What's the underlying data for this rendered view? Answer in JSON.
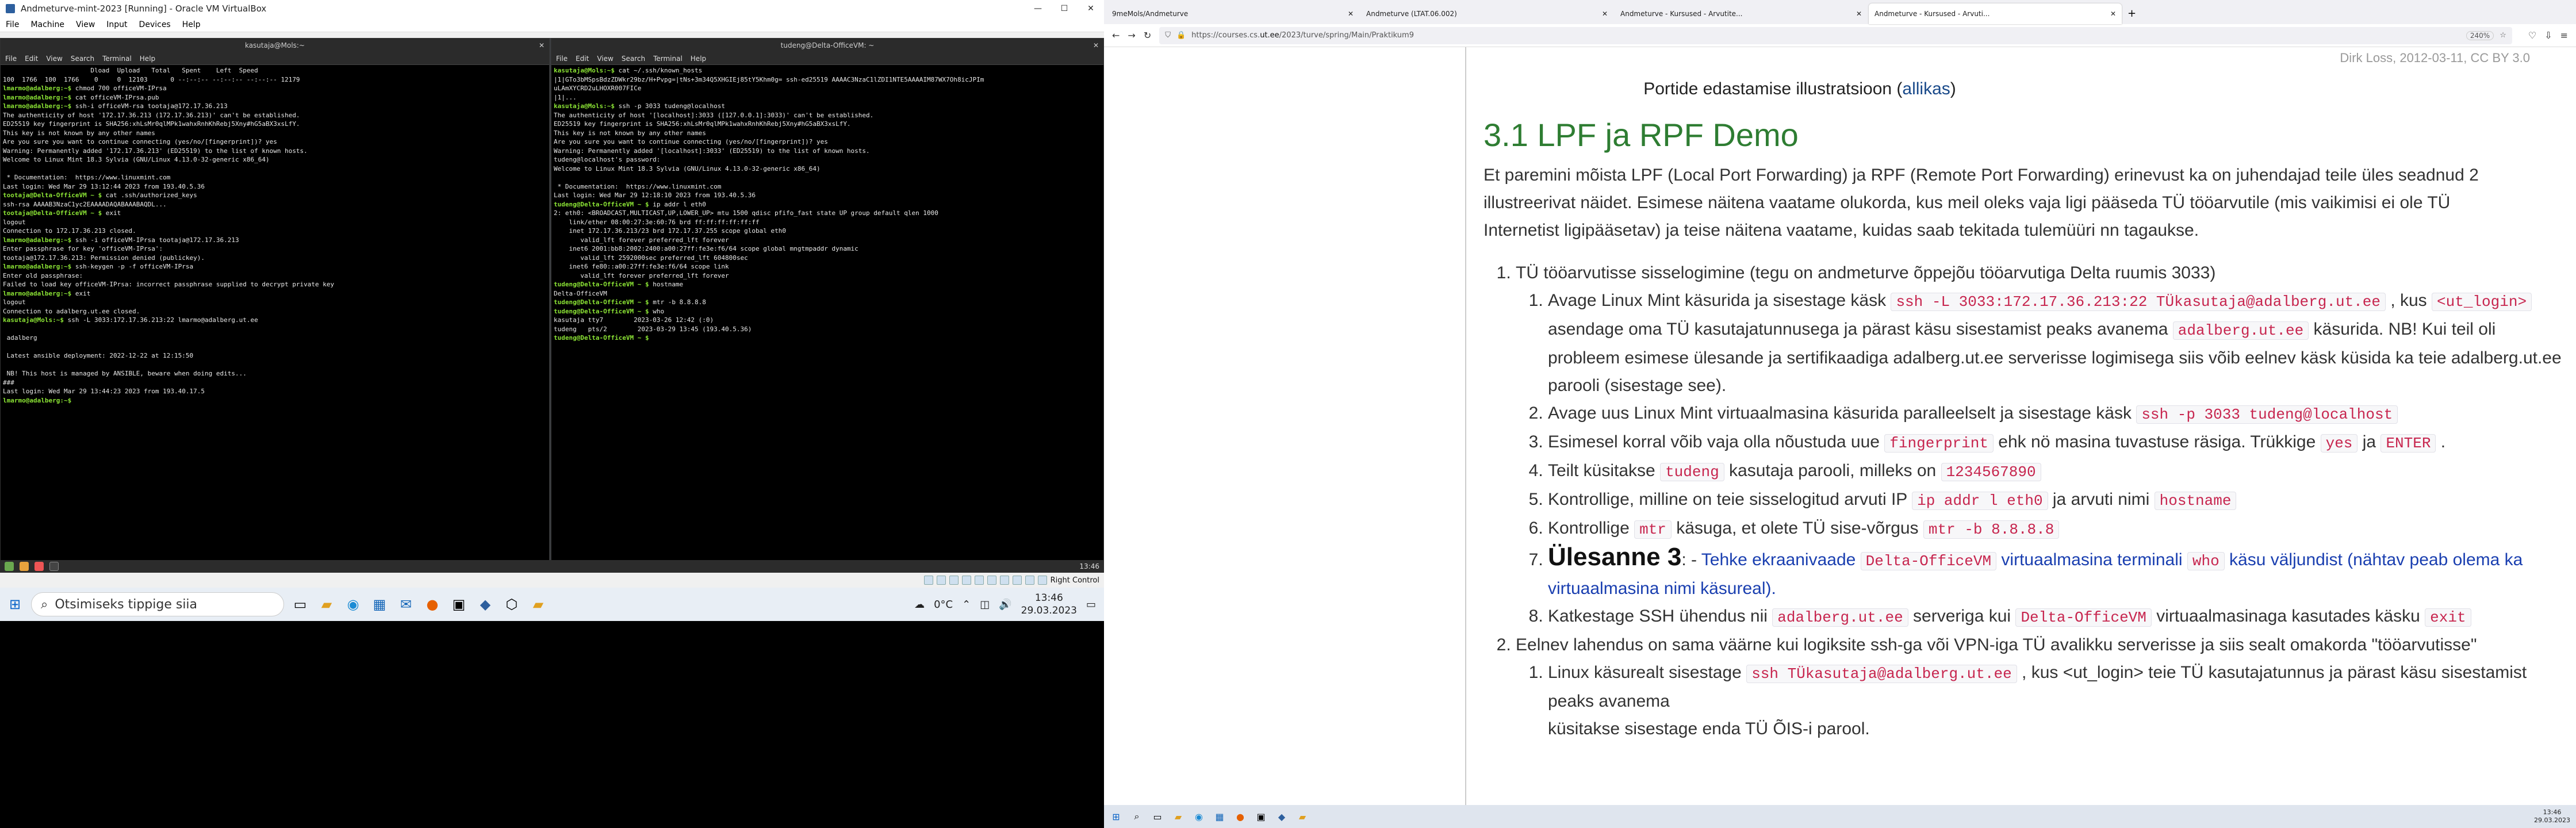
{
  "vbox": {
    "title": "Andmeturve-mint-2023 [Running] - Oracle VM VirtualBox",
    "menu": [
      "File",
      "Machine",
      "View",
      "Input",
      "Devices",
      "Help"
    ]
  },
  "term1": {
    "title": "kasutaja@Mols:~",
    "menu": [
      "File",
      "Edit",
      "View",
      "Search",
      "Terminal",
      "Help"
    ],
    "lines": [
      "                       Dload  Upload   Total   Spent    Left  Speed",
      "100  1766  100  1766    0     0  12103      0 --:--:-- --:--:-- --:--:-- 12179",
      "lmarmo@adalberg:~$ chmod 700 officeVM-IPrsa",
      "lmarmo@adalberg:~$ cat officeVM-IPrsa.pub",
      "lmarmo@adalberg:~$ ssh-i officeVM-rsa tootaja@172.17.36.213",
      "The authenticity of host '172.17.36.213 (172.17.36.213)' can't be established.",
      "ED25519 key fingerprint is SHA256:xhLsMr0qlMPk1wahxRnhKhRebj5Xny#hG5aBX3xsLfY.",
      "This key is not known by any other names",
      "Are you sure you want to continue connecting (yes/no/[fingerprint])? yes",
      "Warning: Permanently added '172.17.36.213' (ED25519) to the list of known hosts.",
      "Welcome to Linux Mint 18.3 Sylvia (GNU/Linux 4.13.0-32-generic x86_64)",
      "",
      " * Documentation:  https://www.linuxmint.com",
      "Last login: Wed Mar 29 13:12:44 2023 from 193.40.5.36",
      "tootaja@Delta-OfficeVM ~ $ cat .ssh/authorized_keys",
      "ssh-rsa AAAAB3NzaC1yc2EAAAADAQABAAABAQDL...",
      "tootaja@Delta-OfficeVM ~ $ exit",
      "logout",
      "Connection to 172.17.36.213 closed.",
      "lmarmo@adalberg:~$ ssh -i officeVM-IPrsa tootaja@172.17.36.213",
      "Enter passphrase for key 'officeVM-IPrsa':",
      "tootaja@172.17.36.213: Permission denied (publickey).",
      "lmarmo@adalberg:~$ ssh-keygen -p -f officeVM-IPrsa",
      "Enter old passphrase:",
      "Failed to load key officeVM-IPrsa: incorrect passphrase supplied to decrypt private key",
      "lmarmo@adalberg:~$ exit",
      "logout",
      "Connection to adalberg.ut.ee closed.",
      "kasutaja@Mols:~$ ssh -L 3033:172.17.36.213:22 lmarmo@adalberg.ut.ee",
      "",
      " adalberg",
      "",
      " Latest ansible deployment: 2022-12-22 at 12:15:50",
      "",
      " NB! This host is managed by ANSIBLE, beware when doing edits...",
      "###",
      "Last login: Wed Mar 29 13:44:23 2023 from 193.40.17.5",
      "lmarmo@adalberg:~$ "
    ]
  },
  "term2": {
    "title": "tudeng@Delta-OfficeVM: ~",
    "menu": [
      "File",
      "Edit",
      "View",
      "Search",
      "Terminal",
      "Help"
    ],
    "lines": [
      "kasutaja@Mols:~$ cat ~/.ssh/known_hosts",
      "|1|GTo3bMSpsBdzZDWkr29bz/H+Pvpg=|tNs+3m34Q5XHGIEj85tY5Khm0g= ssh-ed25519 AAAAC3NzaC1lZDI1NTE5AAAAIM87WX7Oh8icJPIm",
      "uLAmXYCRD2uLHOXR007FICe",
      "|1|...",
      "kasutaja@Mols:~$ ssh -p 3033 tudeng@localhost",
      "The authenticity of host '[localhost]:3033 ([127.0.0.1]:3033)' can't be established.",
      "ED25519 key fingerprint is SHA256:xhLsMr0qlMPk1wahxRnhKhRebj5Xny#hG5aBX3xsLfY.",
      "This key is not known by any other names",
      "Are you sure you want to continue connecting (yes/no/[fingerprint])? yes",
      "Warning: Permanently added '[localhost]:3033' (ED25519) to the list of known hosts.",
      "tudeng@localhost's password:",
      "Welcome to Linux Mint 18.3 Sylvia (GNU/Linux 4.13.0-32-generic x86_64)",
      "",
      " * Documentation:  https://www.linuxmint.com",
      "Last login: Wed Mar 29 12:18:10 2023 from 193.40.5.36",
      "tudeng@Delta-OfficeVM ~ $ ip addr l eth0",
      "2: eth0: <BROADCAST,MULTICAST,UP,LOWER_UP> mtu 1500 qdisc pfifo_fast state UP group default qlen 1000",
      "    link/ether 08:00:27:3e:60:76 brd ff:ff:ff:ff:ff:ff",
      "    inet 172.17.36.213/23 brd 172.17.37.255 scope global eth0",
      "       valid_lft forever preferred_lft forever",
      "    inet6 2001:bb8:2002:2400:a00:27ff:fe3e:f6/64 scope global mngtmpaddr dynamic",
      "       valid_lft 2592000sec preferred_lft 604800sec",
      "    inet6 fe80::a00:27ff:fe3e:f6/64 scope link",
      "       valid_lft forever preferred_lft forever",
      "tudeng@Delta-OfficeVM ~ $ hostname",
      "Delta-OfficeVM",
      "tudeng@Delta-OfficeVM ~ $ mtr -b 8.8.8.8",
      "tudeng@Delta-OfficeVM ~ $ who",
      "kasutaja tty7        2023-03-26 12:42 (:0)",
      "tudeng   pts/2        2023-03-29 13:45 (193.40.5.36)",
      "tudeng@Delta-OfficeVM ~ $ "
    ]
  },
  "guest_clock": "13:46",
  "vbox_status": {
    "host_key": "Right Control"
  },
  "taskbar1": {
    "search": "Otsimiseks tippige siia",
    "weather": "0°C",
    "time": "13:46",
    "date": "29.03.2023"
  },
  "browser": {
    "tabs": [
      {
        "label": "9meMols/Andmeturve"
      },
      {
        "label": "Andmeturve (LTAT.06.002)"
      },
      {
        "label": "Andmeturve - Kursused - Arvutite..."
      },
      {
        "label": "Andmeturve - Kursused - Arvuti..."
      }
    ],
    "url_prefix": "https://courses.cs.",
    "url_host": "ut.ee",
    "url_path": "/2023/turve/spring/Main/Praktikum9",
    "zoom": "240%"
  },
  "page": {
    "credit": "Dirk Loss, 2012-03-11, CC BY 3.0",
    "caption_pre": "Portide edastamise illustratsioon (",
    "caption_link": "allikas",
    "caption_post": ")",
    "heading": "3.1 LPF ja RPF Demo",
    "intro": "Et paremini mõista LPF (Local Port Forwarding) ja RPF (Remote Port Forwarding) erinevust ka on juhendajad teile üles seadnud 2 illustreerivat näidet. Esimese näitena vaatame olukorda, kus meil oleks vaja ligi pääseda TÜ tööarvutile (mis vaikimisi ei ole TÜ Internetist ligipääsetav) ja teise näitena vaatame, kuidas saab tekitada tulemüüri nn tagaukse.",
    "item1": "TÜ tööarvutisse sisselogimine (tegu on andmeturve õppejõu tööarvutiga Delta ruumis 3033)",
    "s1a": "Avage Linux Mint käsurida ja sisestage käsk ",
    "s1code": "ssh -L 3033:172.17.36.213:22 TÜkasutaja@adalberg.ut.ee",
    "s1b": " , kus ",
    "s1code2": "<ut_login>",
    "s1c": " asendage oma TÜ kasutajatunnusega ja pärast käsu sisestamist peaks avanema ",
    "s1code3": "adalberg.ut.ee",
    "s1d": " käsurida. NB! Kui teil oli probleem esimese ülesande ja sertifikaadiga adalberg.ut.ee serverisse logimisega siis võib eelnev käsk küsida ka teie adalberg.ut.ee parooli (sisestage see).",
    "s2a": "Avage uus Linux Mint virtuaalmasina käsurida paralleelselt ja sisestage käsk ",
    "s2code": "ssh -p 3033 tudeng@localhost",
    "s3a": "Esimesel korral võib vaja olla nõustuda uue ",
    "s3code": "fingerprint",
    "s3b": " ehk nö masina tuvastuse räsiga. Trükkige ",
    "s3code2": "yes",
    "s3c": " ja ",
    "s3code3": "ENTER",
    "s3d": " .",
    "s4a": "Teilt küsitakse ",
    "s4code": "tudeng",
    "s4b": " kasutaja parooli, milleks on ",
    "s4code2": "1234567890",
    "s5a": "Kontrollige, milline on teie sisselogitud arvuti IP ",
    "s5code": "ip addr l eth0",
    "s5b": " ja arvuti nimi ",
    "s5code2": "hostname",
    "s6a": "Kontrollige ",
    "s6code": "mtr",
    "s6b": " käsuga, et olete TÜ sise-võrgus ",
    "s6code2": "mtr -b 8.8.8.8",
    "s7big": "Ülesanne 3",
    "s7a": ": - ",
    "s7b": "Tehke ekraanivaade ",
    "s7code": "Delta-OfficeVM",
    "s7c": " virtuaalmasina terminali ",
    "s7code2": "who",
    "s7d": " käsu väljundist (nähtav peab olema ka virtuaalmasina nimi käsureal).",
    "s8a": "Katkestage SSH ühendus nii ",
    "s8code": "adalberg.ut.ee",
    "s8b": " serveriga kui ",
    "s8code2": "Delta-OfficeVM",
    "s8c": " virtuaalmasinaga kasutades käsku ",
    "s8code3": "exit",
    "item2": "Eelnev lahendus on sama väärne kui logiksite ssh-ga või VPN-iga TÜ avalikku serverisse ja siis sealt omakorda \"tööarvutisse\"",
    "i2a": "Linux käsurealt sisestage ",
    "i2code": "ssh TÜkasutaja@adalberg.ut.ee",
    "i2b": " , kus <ut_login> teie TÜ kasutajatunnus ja pärast käsu sisestamist peaks avanema",
    "i2c": "küsitakse sisestage enda TÜ ÕIS-i parool."
  },
  "taskbar2": {
    "time": "13:46",
    "date": "29.03.2023"
  }
}
